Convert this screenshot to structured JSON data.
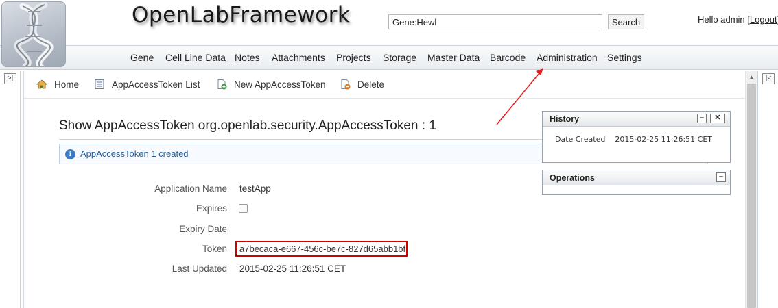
{
  "header": {
    "app_title": "OpenLabFramework",
    "search_value": "Gene:Hewl",
    "search_button": "Search",
    "greeting": "Hello admin [",
    "logout_label": "Logout",
    "greeting_end": "]"
  },
  "nav": {
    "items": [
      {
        "label": "Gene"
      },
      {
        "label": "Cell Line Data"
      },
      {
        "label": "Notes"
      },
      {
        "label": "Attachments"
      },
      {
        "label": "Projects"
      },
      {
        "label": "Storage"
      },
      {
        "label": "Master Data"
      },
      {
        "label": "Barcode"
      },
      {
        "label": "Administration"
      },
      {
        "label": "Settings"
      }
    ]
  },
  "toolbar": {
    "home": "Home",
    "list": "AppAccessToken List",
    "new": "New AppAccessToken",
    "delete": "Delete"
  },
  "main": {
    "heading": "Show AppAccessToken org.openlab.security.AppAccessToken : 1",
    "message": "AppAccessToken 1 created",
    "properties": {
      "application_name_label": "Application Name",
      "application_name_value": "testApp",
      "expires_label": "Expires",
      "expires_checked": false,
      "expiry_date_label": "Expiry Date",
      "expiry_date_value": "",
      "token_label": "Token",
      "token_value": "a7becaca-e667-456c-be7c-827d65abb1bf",
      "last_updated_label": "Last Updated",
      "last_updated_value": "2015-02-25 11:26:51 CET"
    }
  },
  "side_panels": {
    "history": {
      "title": "History",
      "date_created_label": "Date Created",
      "date_created_value": "2015-02-25 11:26:51 CET"
    },
    "operations": {
      "title": "Operations"
    }
  },
  "colors": {
    "highlight_red": "#d40000",
    "info_blue": "#2a5f9a",
    "annotation_arrow": "#e02020"
  },
  "icons": {
    "left_rail": "expand-left-icon",
    "right_rail": "collapse-right-icon",
    "home": "home-icon",
    "list": "list-icon",
    "new": "new-document-icon",
    "delete": "delete-document-icon",
    "info": "info-icon"
  }
}
